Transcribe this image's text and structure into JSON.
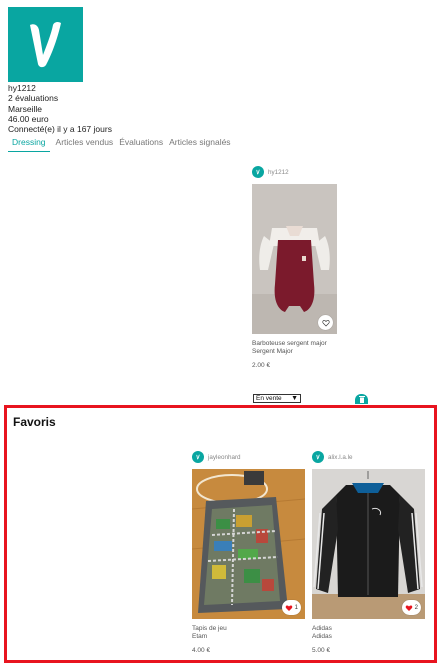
{
  "brand": {
    "accent": "#09a6a1",
    "highlight": "#e8141f"
  },
  "profile": {
    "username": "hy1212",
    "ratings": "2 évaluations",
    "city": "Marseille",
    "balance": "46.00 euro",
    "last_seen": "Connecté(e) il y a 167 jours"
  },
  "tabs": [
    {
      "label": "Dressing",
      "active": true
    },
    {
      "label": "Articles vendus",
      "active": false
    },
    {
      "label": "Évaluations",
      "active": false
    },
    {
      "label": "Articles signalés",
      "active": false
    }
  ],
  "dressing": {
    "item": {
      "seller": "hy1212",
      "title": "Barboteuse sergent major",
      "brand": "Sergent Major",
      "price": "2.00 €",
      "icon": "heart-outline-icon"
    },
    "status_select": {
      "value": "En vente"
    }
  },
  "favoris": {
    "title": "Favoris",
    "items": [
      {
        "seller": "jayleonhard",
        "title": "Tapis de jeu",
        "brand": "Etam",
        "price": "4.00 €",
        "likes": "1",
        "icon": "heart-filled-icon"
      },
      {
        "seller": "alix.l.a.le",
        "title": "Adidas",
        "brand": "Adidas",
        "price": "5.00 €",
        "likes": "2",
        "icon": "heart-filled-icon"
      }
    ]
  }
}
